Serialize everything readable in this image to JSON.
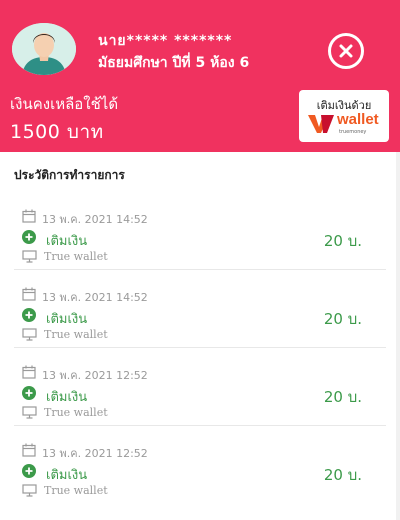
{
  "header": {
    "user_name": "นาย***** *******",
    "user_class": "มัธยมศึกษา ปีที่ 5 ห้อง 6",
    "balance_label": "เงินคงเหลือใช้ได้",
    "balance_amount": "1500 บาท",
    "topup_label": "เติมเงินด้วย",
    "wallet_logo_text": "wallet",
    "wallet_logo_sub": "truemoney"
  },
  "history": {
    "title": "ประวัติการทำรายการ",
    "items": [
      {
        "date": "13 พ.ค. 2021 14:52",
        "type": "เติมเงิน",
        "amount": "20 บ.",
        "channel": "True wallet"
      },
      {
        "date": "13 พ.ค. 2021 14:52",
        "type": "เติมเงิน",
        "amount": "20 บ.",
        "channel": "True wallet"
      },
      {
        "date": "13 พ.ค. 2021 12:52",
        "type": "เติมเงิน",
        "amount": "20 บ.",
        "channel": "True wallet"
      },
      {
        "date": "13 พ.ค. 2021 12:52",
        "type": "เติมเงิน",
        "amount": "20 บ.",
        "channel": "True wallet"
      }
    ]
  },
  "icons": {
    "avatar": "user-avatar",
    "close": "close-circle-icon",
    "calendar": "calendar-icon",
    "topup": "plus-circle-icon",
    "channel": "monitor-icon",
    "wallet": "truemoney-wallet-logo"
  },
  "colors": {
    "header_bg": "#f0325f",
    "amount_green": "#3c9a4a",
    "muted_gray": "#9a9a9a",
    "wallet_orange": "#f05a22"
  }
}
